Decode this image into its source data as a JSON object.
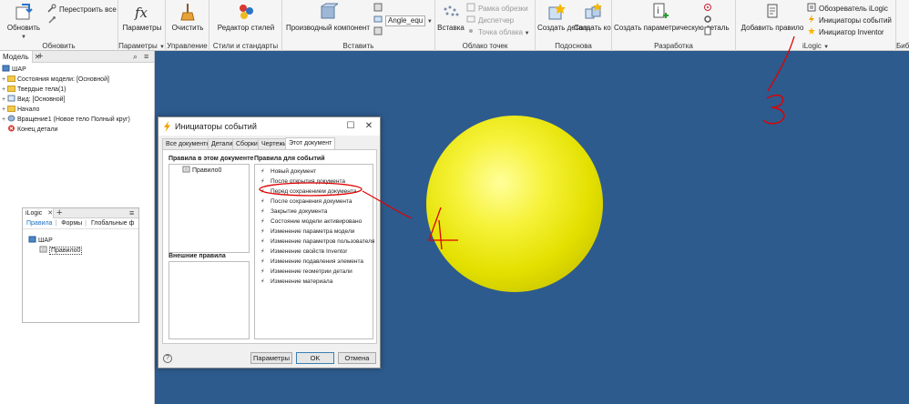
{
  "ribbon": {
    "groups": {
      "update": "Обновить",
      "parameters": "Параметры",
      "management": "Управление",
      "styles": "Стили и стандарты",
      "insert": "Вставить",
      "point_cloud": "Облако точек",
      "base": "Подоснова",
      "development": "Разработка",
      "ilogic": "iLogic",
      "library": "Биб"
    },
    "buttons": {
      "refresh": "Обновить",
      "rebuild_all": "Перестроить все",
      "parameters": "Параметры",
      "purge": "Очистить",
      "style_editor": "Редактор стилей",
      "derived_component": "Производный компонент",
      "angle_dropdown": "Angle_equ",
      "insert": "Вставка",
      "crop_box": "Рамка обрезки",
      "dispatcher": "Диспетчер",
      "cloud_point": "Точка облака",
      "create_part": "Создать деталь",
      "create_components": "Создать компоненты",
      "create_param_part": "Создать параметрическую деталь",
      "add_rule": "Добавить правило",
      "ilogic_browser": "Обозреватель iLogic",
      "event_triggers": "Инициаторы событий",
      "inventor_triggers": "Инициатор Inventor"
    }
  },
  "browser": {
    "tab_label": "Модель",
    "items": [
      {
        "label": "ШАР"
      },
      {
        "label": "Состояния модели: [Основной]"
      },
      {
        "label": "Твердые тела(1)"
      },
      {
        "label": "Вид: [Основной]"
      },
      {
        "label": "Начало"
      },
      {
        "label": "Вращение1 (Новое тело Полный круг)"
      },
      {
        "label": "Конец детали"
      }
    ]
  },
  "ilogic_panel": {
    "tab_label": "iLogic",
    "subtabs": [
      "Правила",
      "Формы",
      "Глобальные ф"
    ],
    "root": "ШАР",
    "rule": "Правило0"
  },
  "dialog": {
    "title": "Инициаторы событий",
    "tabs": [
      "Все документы",
      "Детали",
      "Сборки",
      "Чертежи",
      "Этот документ"
    ],
    "active_tab": "Этот документ",
    "rules_in_doc_header": "Правила в этом документе",
    "rules_in_doc": [
      "Правило0"
    ],
    "external_rules_header": "Внешние правила",
    "events_header": "Правила для событий",
    "events": [
      "Новый документ",
      "После открытия документа",
      "Перед сохранением документа",
      "После сохранения документа",
      "Закрытие документа",
      "Состояние модели активировано",
      "Изменение параметра модели",
      "Изменение параметров пользователя",
      "Изменение свойств Inventor",
      "Изменение подавления элемента",
      "Изменение геометрии детали",
      "Изменение материала"
    ],
    "highlighted_event": "Перед сохранением документа",
    "buttons": {
      "parameters": "Параметры",
      "ok": "OK",
      "cancel": "Отмена"
    },
    "help": "?"
  },
  "colors": {
    "viewport": "#2d5b8d",
    "ball": "#e3e000",
    "annotation": "#e00000",
    "bolt": "#f5a300"
  }
}
